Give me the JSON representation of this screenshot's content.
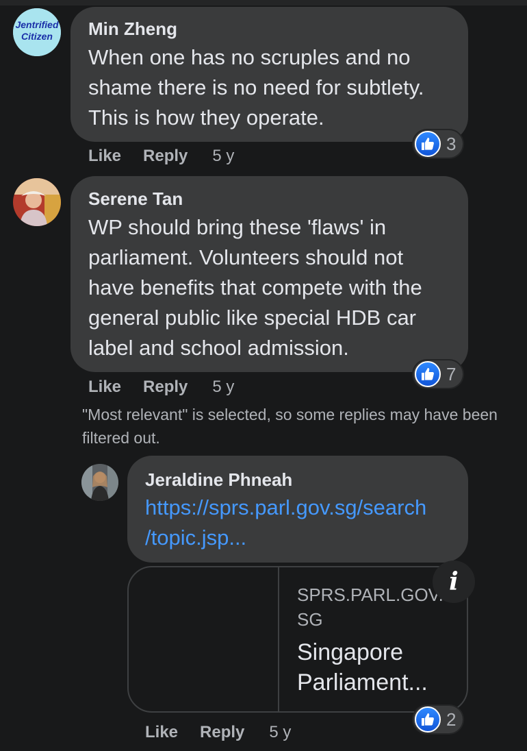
{
  "comments": [
    {
      "author": "Min Zheng",
      "avatar_text_1": "Jentrified",
      "avatar_text_2": "Citizen",
      "text": "When one has no scruples and no\nshame there is no need for subtlety.\nThis is how they operate.",
      "like_label": "Like",
      "reply_label": "Reply",
      "time": "5 y",
      "reactions": "3"
    },
    {
      "author": "Serene Tan",
      "text": "WP should bring these 'flaws' in\nparliament. Volunteers should not\nhave benefits that compete with the\ngeneral public like special HDB car\nlabel and school admission.",
      "like_label": "Like",
      "reply_label": "Reply",
      "time": "5 y",
      "reactions": "7"
    }
  ],
  "filter_notice": "\"Most relevant\" is selected, so some replies may have been filtered out.",
  "reply": {
    "author": "Jeraldine Phneah",
    "link": "https://sprs.parl.gov.sg/search\n/topic.jsp...",
    "preview_domain": "SPRS.PARL.GOV.SG",
    "preview_title": "Singapore\nParliament...",
    "like_label": "Like",
    "reply_label": "Reply",
    "time": "5 y",
    "reactions": "2"
  },
  "colors": {
    "background": "#18191a",
    "bubble": "#3a3b3c",
    "link": "#4599ff",
    "like_blue": "#2e89ff"
  },
  "icons": [
    "like-thumb-icon",
    "info-icon"
  ]
}
